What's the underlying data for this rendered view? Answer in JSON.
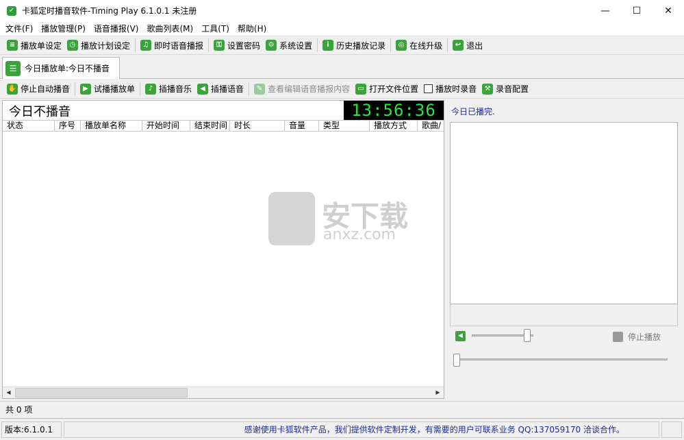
{
  "window": {
    "title": "卡狐定时播音软件-Timing Play 6.1.0.1  未注册",
    "minimize_glyph": "—",
    "maximize_glyph": "☐",
    "close_glyph": "✕"
  },
  "menu": [
    "文件(F)",
    "播放管理(P)",
    "语音播报(V)",
    "歌曲列表(M)",
    "工具(T)",
    "帮助(H)"
  ],
  "toolbar1": {
    "playlist_setup": "播放单设定",
    "plan_setup": "播放计划设定",
    "instant_voice": "即时语音播报",
    "set_password": "设置密码",
    "system_settings": "系统设置",
    "history": "历史播放记录",
    "online_upgrade": "在线升级",
    "exit": "退出"
  },
  "tab": {
    "label": "今日播放单:今日不播音"
  },
  "toolbar2": {
    "stop_auto": "停止自动播音",
    "trial_play": "试播播放单",
    "insert_music": "插播音乐",
    "insert_voice": "插播语音",
    "view_edit_voice": "查看编辑语音播报内容",
    "open_file_location": "打开文件位置",
    "record_on_play": "播放时录音",
    "record_config": "录音配置"
  },
  "main": {
    "today_label": "今日不播音",
    "clock": "13:56:36",
    "columns": [
      "状态",
      "序号",
      "播放单名称",
      "开始时间",
      "结束时间",
      "时长",
      "音量",
      "类型",
      "播放方式",
      "歌曲/"
    ]
  },
  "right": {
    "done_label": "今日已播完.",
    "stop_label": "停止播放",
    "volume_level": 0.9,
    "progress_level": 0.0
  },
  "watermark": {
    "text": "安下载",
    "sub": "anxz.com"
  },
  "count": "共 0 项",
  "status": {
    "version": "版本:6.1.0.1",
    "thanks": "感谢使用卡狐软件产品，我们提供软件定制开发，有需要的用户可联系业务 QQ:137059170 洽谈合作。"
  }
}
